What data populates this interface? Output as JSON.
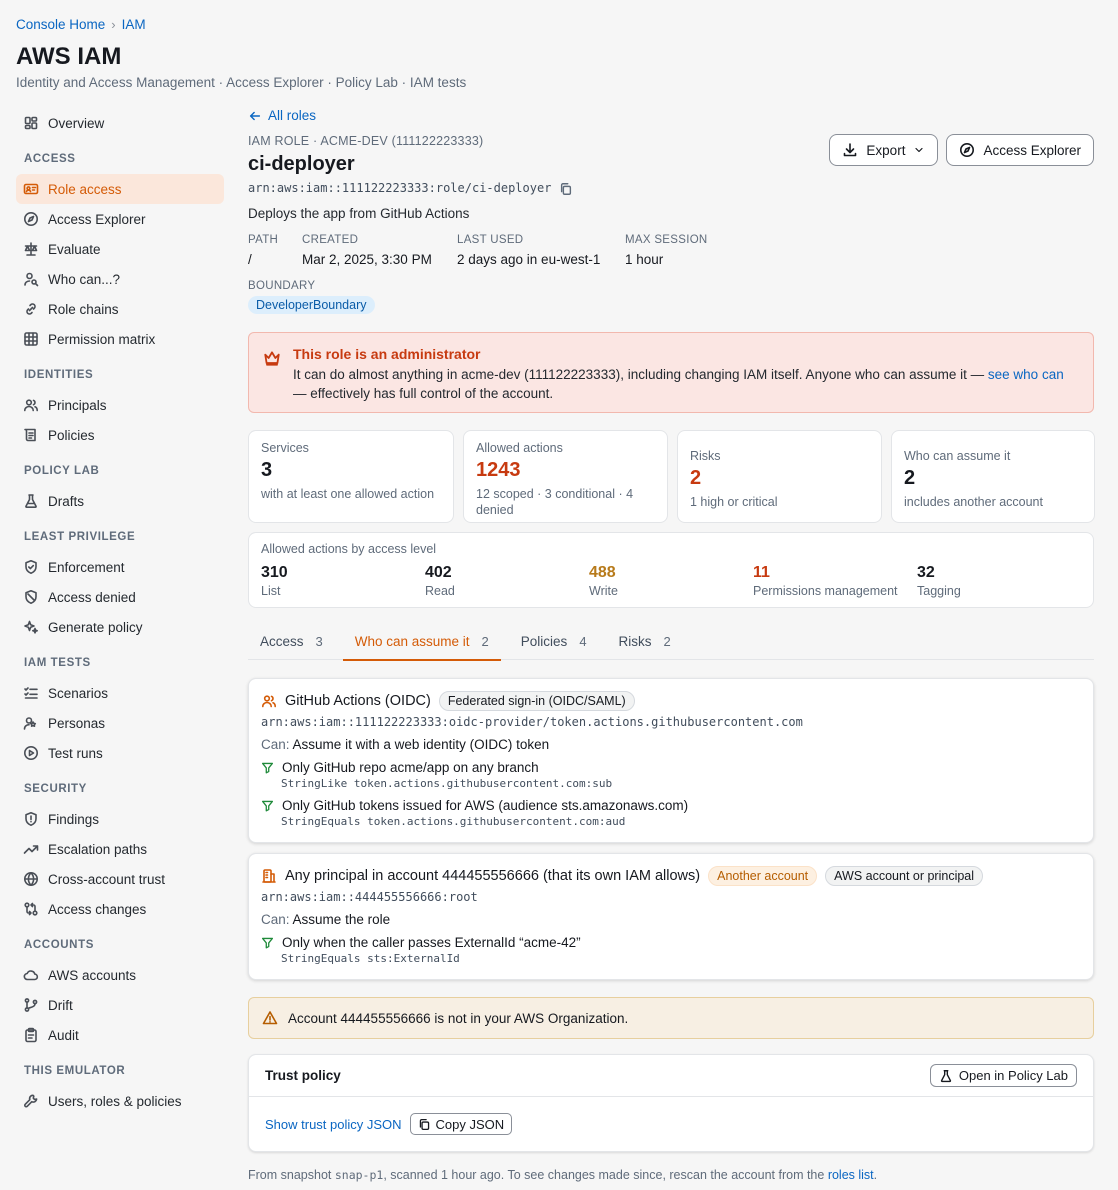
{
  "breadcrumb": {
    "home": "Console Home",
    "sep": "›",
    "current": "IAM"
  },
  "page": {
    "title": "AWS IAM",
    "subtitle": "Identity and Access Management · Access Explorer · Policy Lab · IAM tests"
  },
  "sidebar": {
    "top": [
      {
        "label": "Overview",
        "icon": "dashboard-icon"
      }
    ],
    "sections": [
      {
        "title": "ACCESS",
        "items": [
          {
            "label": "Role access",
            "icon": "id-card-icon",
            "active": true
          },
          {
            "label": "Access Explorer",
            "icon": "compass-icon"
          },
          {
            "label": "Evaluate",
            "icon": "scale-icon"
          },
          {
            "label": "Who can...?",
            "icon": "user-search-icon"
          },
          {
            "label": "Role chains",
            "icon": "link-icon"
          },
          {
            "label": "Permission matrix",
            "icon": "grid-icon"
          }
        ]
      },
      {
        "title": "IDENTITIES",
        "items": [
          {
            "label": "Principals",
            "icon": "users-icon"
          },
          {
            "label": "Policies",
            "icon": "scroll-icon"
          }
        ]
      },
      {
        "title": "POLICY LAB",
        "items": [
          {
            "label": "Drafts",
            "icon": "flask-icon"
          }
        ]
      },
      {
        "title": "LEAST PRIVILEGE",
        "items": [
          {
            "label": "Enforcement",
            "icon": "shield-check-icon"
          },
          {
            "label": "Access denied",
            "icon": "ban-icon"
          },
          {
            "label": "Generate policy",
            "icon": "sparkles-icon"
          }
        ]
      },
      {
        "title": "IAM TESTS",
        "items": [
          {
            "label": "Scenarios",
            "icon": "list-check-icon"
          },
          {
            "label": "Personas",
            "icon": "user-circle-icon"
          },
          {
            "label": "Test runs",
            "icon": "play-circle-icon"
          }
        ]
      },
      {
        "title": "SECURITY",
        "items": [
          {
            "label": "Findings",
            "icon": "shield-alert-icon"
          },
          {
            "label": "Escalation paths",
            "icon": "trend-up-icon"
          },
          {
            "label": "Cross-account trust",
            "icon": "globe-icon"
          },
          {
            "label": "Access changes",
            "icon": "git-compare-icon"
          }
        ]
      },
      {
        "title": "ACCOUNTS",
        "items": [
          {
            "label": "AWS accounts",
            "icon": "cloud-icon"
          },
          {
            "label": "Drift",
            "icon": "branch-icon"
          },
          {
            "label": "Audit",
            "icon": "clipboard-icon"
          }
        ]
      },
      {
        "title": "THIS EMULATOR",
        "items": [
          {
            "label": "Users, roles & policies",
            "icon": "wrench-icon"
          }
        ]
      }
    ]
  },
  "role": {
    "back_label": "All roles",
    "kicker": "IAM ROLE · ACME-DEV (111122223333)",
    "name": "ci-deployer",
    "arn": "arn:aws:iam::111122223333:role/ci-deployer",
    "description": "Deploys the app from GitHub Actions",
    "export_label": "Export",
    "explorer_label": "Access Explorer",
    "meta": [
      {
        "label": "PATH",
        "value": "/"
      },
      {
        "label": "CREATED",
        "value": "Mar 2, 2025, 3:30 PM"
      },
      {
        "label": "LAST USED",
        "value": "2 days ago in eu-west-1"
      },
      {
        "label": "MAX SESSION",
        "value": "1 hour"
      }
    ],
    "boundary_label": "BOUNDARY",
    "boundary_value": "DeveloperBoundary"
  },
  "admin_alert": {
    "title": "This role is an administrator",
    "body_before": "It can do almost anything in acme-dev (111122223333), including changing IAM itself. Anyone who can assume it — ",
    "link": "see who can",
    "body_after": "— effectively has full control of the account."
  },
  "stats": [
    {
      "label": "Services",
      "value": "3",
      "sub": "with at least one allowed action",
      "color": "default"
    },
    {
      "label": "Allowed actions",
      "value": "1243",
      "sub": "12 scoped · 3 conditional · 4 denied",
      "color": "red"
    },
    {
      "label": "Risks",
      "value": "2",
      "sub": "1 high or critical",
      "color": "red"
    },
    {
      "label": "Who can assume it",
      "value": "2",
      "sub": "includes another account",
      "color": "default"
    }
  ],
  "access_levels": {
    "title": "Allowed actions by access level",
    "items": [
      {
        "value": "310",
        "label": "List",
        "color": "default"
      },
      {
        "value": "402",
        "label": "Read",
        "color": "default"
      },
      {
        "value": "488",
        "label": "Write",
        "color": "orange"
      },
      {
        "value": "11",
        "label": "Permissions management",
        "color": "red"
      },
      {
        "value": "32",
        "label": "Tagging",
        "color": "default"
      }
    ]
  },
  "tabs": [
    {
      "label": "Access",
      "count": "3"
    },
    {
      "label": "Who can assume it",
      "count": "2",
      "active": true
    },
    {
      "label": "Policies",
      "count": "4"
    },
    {
      "label": "Risks",
      "count": "2"
    }
  ],
  "principals": [
    {
      "icon": "users-icon",
      "name": "GitHub Actions (OIDC)",
      "badges": [
        {
          "text": "Federated sign-in (OIDC/SAML)",
          "style": "gray"
        }
      ],
      "arn": "arn:aws:iam::111122223333:oidc-provider/token.actions.githubusercontent.com",
      "can_label": "Can:",
      "can": "Assume it with a web identity (OIDC) token",
      "conditions": [
        {
          "title": "Only GitHub repo acme/app on any branch",
          "detail": "StringLike token.actions.githubusercontent.com:sub"
        },
        {
          "title": "Only GitHub tokens issued for AWS (audience sts.amazonaws.com)",
          "detail": "StringEquals token.actions.githubusercontent.com:aud"
        }
      ]
    },
    {
      "icon": "building-icon",
      "name": "Any principal in account 444455556666 (that its own IAM allows)",
      "badges": [
        {
          "text": "Another account",
          "style": "orange"
        },
        {
          "text": "AWS account or principal",
          "style": "gray"
        }
      ],
      "arn": "arn:aws:iam::444455556666:root",
      "can_label": "Can:",
      "can": "Assume the role",
      "conditions": [
        {
          "title": "Only when the caller passes ExternalId “acme-42”",
          "detail": "StringEquals sts:ExternalId"
        }
      ]
    }
  ],
  "org_warning": "Account 444455556666 is not in your AWS Organization.",
  "trust_policy": {
    "title": "Trust policy",
    "open_label": "Open in Policy Lab",
    "show_label": "Show trust policy JSON",
    "copy_label": "Copy JSON"
  },
  "footer": {
    "before": "From snapshot ",
    "snapshot": "snap-p1",
    "middle": ", scanned 1 hour ago. To see changes made since, rescan the account from the ",
    "link": "roles list",
    "after": "."
  }
}
